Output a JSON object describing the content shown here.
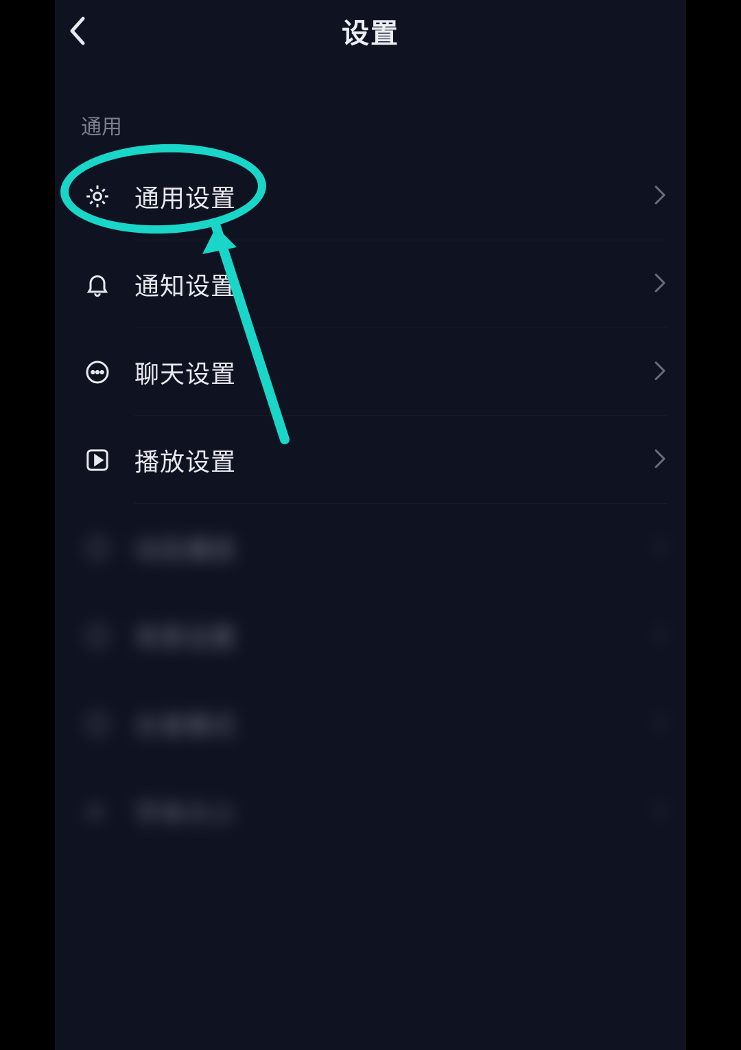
{
  "header": {
    "title": "设置"
  },
  "section": {
    "label": "通用"
  },
  "rows": [
    {
      "label": "通用设置",
      "icon": "gear",
      "blurred": false
    },
    {
      "label": "通知设置",
      "icon": "bell",
      "blurred": false
    },
    {
      "label": "聊天设置",
      "icon": "chat",
      "blurred": false
    },
    {
      "label": "播放设置",
      "icon": "play",
      "blurred": false
    },
    {
      "label": "动态播放",
      "icon": "circle",
      "blurred": true
    },
    {
      "label": "背景设置",
      "icon": "shield",
      "blurred": true
    },
    {
      "label": "长者模式",
      "icon": "circle",
      "blurred": true
    },
    {
      "label": "字体大小",
      "icon": "font",
      "blurred": true
    }
  ],
  "annotation": {
    "highlight_target": "通用设置",
    "color": "#19d6c9"
  }
}
